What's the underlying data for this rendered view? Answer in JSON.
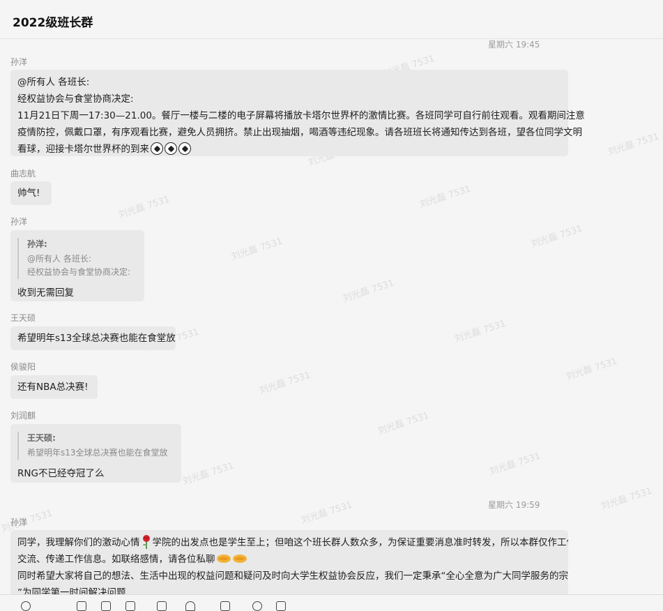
{
  "header": {
    "title": "2022级班长群"
  },
  "watermark": "刘光磊 7531",
  "timestamps": [
    "星期六 19:45",
    "星期六 19:59"
  ],
  "messages": [
    {
      "sender": "孙洋",
      "lines": [
        "@所有人 各班长:",
        "经权益协会与食堂协商决定:",
        "11月21日下周一17:30—21.00。餐厅一楼与二楼的电子屏幕将播放卡塔尔世界杯的激情比赛。各班同学可自行前往观看。观看期间注意",
        "疫情防控，佩戴口罩，有序观看比赛，避免人员拥挤。禁止出现抽烟，喝酒等违纪现象。请各班班长将通知传达到各班，望各位同学文明",
        "看球，迎接卡塔尔世界杯的到来"
      ],
      "trailing_emoji": "soccer-ball x3"
    },
    {
      "sender": "曲志航",
      "text": "帅气!"
    },
    {
      "sender": "孙洋",
      "quote": {
        "name": "孙洋:",
        "lines": [
          "@所有人 各班长:",
          "经权益协会与食堂协商决定:"
        ]
      },
      "text": "收到无需回复"
    },
    {
      "sender": "王天硕",
      "text": "希望明年s13全球总决赛也能在食堂放"
    },
    {
      "sender": "侯骏阳",
      "text": "还有NBA总决赛!"
    },
    {
      "sender": "刘润麒",
      "quote": {
        "name": "王天硕:",
        "lines": [
          "希望明年s13全球总决赛也能在食堂放"
        ]
      },
      "text": "RNG不已经夺冠了么"
    },
    {
      "sender": "孙洋",
      "line1_a": "同学，我理解你们的激动心情",
      "line1_b": "学院的出发点也是学生至上；但咱这个班长群人数众多，为保证重要消息准时转发，所以本群仅作工作",
      "line2": "交流、传递工作信息。如联络感情，请各位私聊",
      "line3": "同时希望大家将自己的想法、生活中出现的权益问题和疑问及时向大学生权益协会反应，我们一定秉承“全心全意为广大同学服务的宗旨",
      "line4": "”为同学第一时间解决问题"
    }
  ]
}
